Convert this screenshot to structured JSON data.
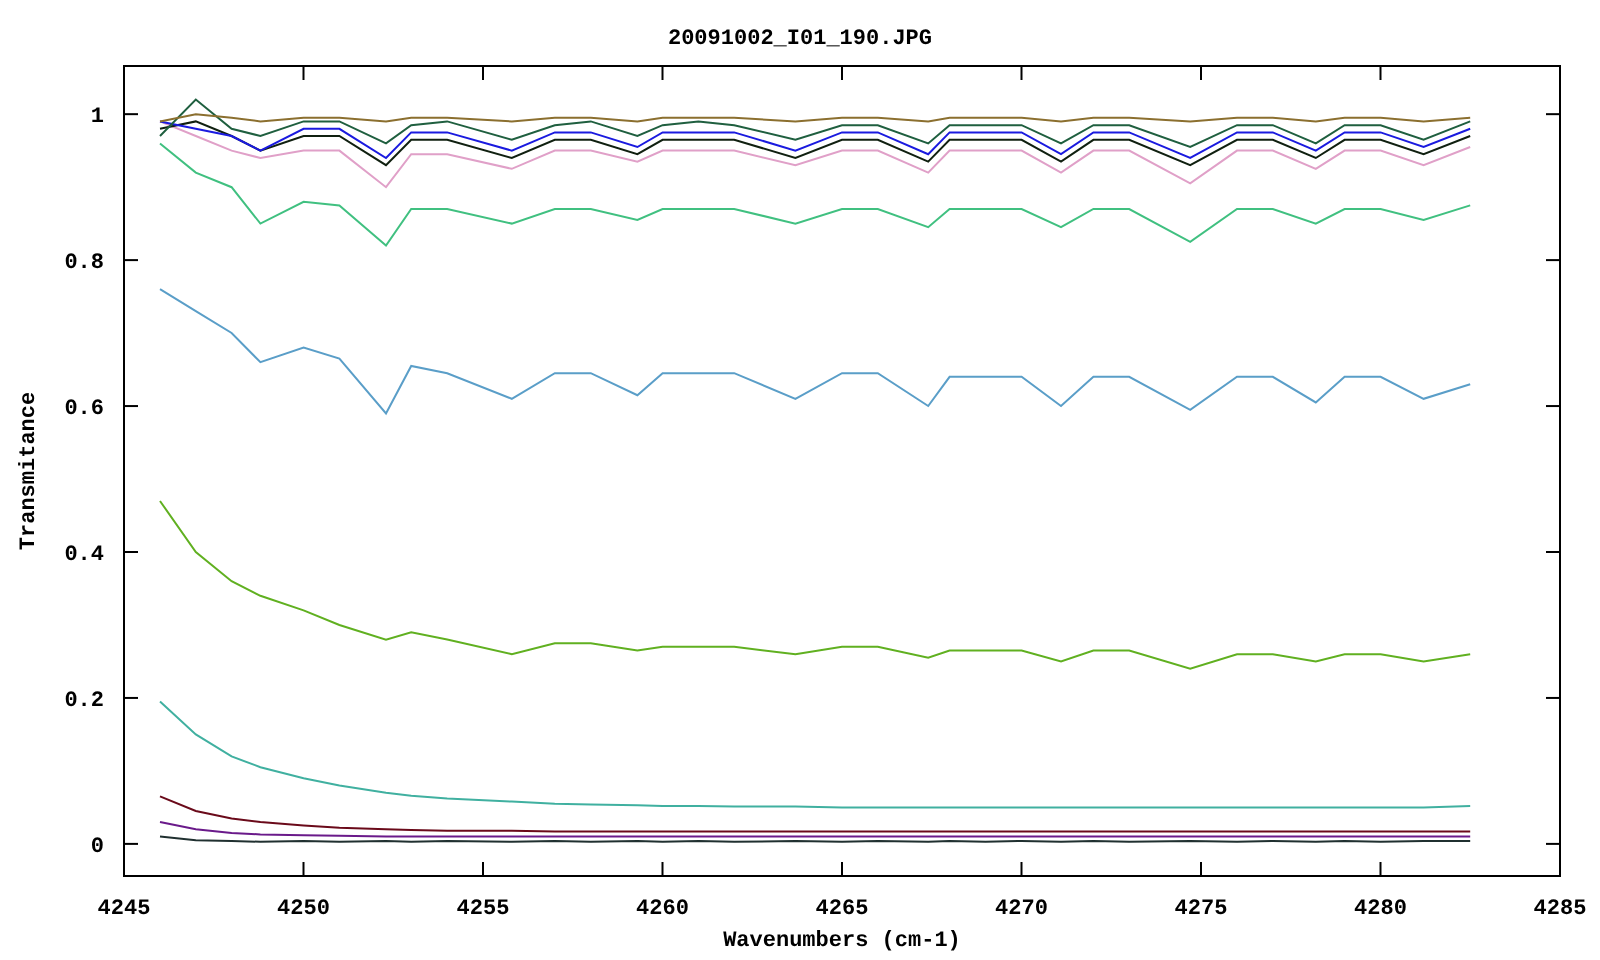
{
  "chart_data": {
    "type": "line",
    "title": "20091002_I01_190.JPG",
    "xlabel": "Wavenumbers (cm-1)",
    "ylabel": "Transmitance",
    "xlim": [
      4245,
      4285
    ],
    "ylim": [
      -0.044,
      1.066
    ],
    "xticks": [
      4245,
      4250,
      4255,
      4260,
      4265,
      4270,
      4275,
      4280,
      4285
    ],
    "yticks": [
      {
        "value": 0,
        "label": "0"
      },
      {
        "value": 0.2,
        "label": "0.2"
      },
      {
        "value": 0.4,
        "label": "0.4"
      },
      {
        "value": 0.6,
        "label": "0.6"
      },
      {
        "value": 0.8,
        "label": "0.8"
      },
      {
        "value": 1,
        "label": "1"
      }
    ],
    "x": [
      4246,
      4247,
      4248,
      4248.8,
      4250,
      4251,
      4252.3,
      4253,
      4254,
      4255.8,
      4257,
      4258,
      4259.3,
      4260,
      4261,
      4262,
      4263.7,
      4265,
      4266,
      4267.4,
      4268,
      4269,
      4270,
      4271.1,
      4272,
      4273,
      4274.7,
      4276,
      4277,
      4278.2,
      4279,
      4280,
      4281.2,
      4282.5
    ],
    "series": [
      {
        "color": "#8b6f2f",
        "values": [
          0.99,
          1.0,
          0.995,
          0.99,
          0.995,
          0.995,
          0.99,
          0.995,
          0.995,
          0.99,
          0.995,
          0.995,
          0.99,
          0.995,
          0.995,
          0.995,
          0.99,
          0.995,
          0.995,
          0.99,
          0.995,
          0.995,
          0.995,
          0.99,
          0.995,
          0.995,
          0.99,
          0.995,
          0.995,
          0.99,
          0.995,
          0.995,
          0.99,
          0.995
        ]
      },
      {
        "color": "#1f5f3f",
        "values": [
          0.97,
          1.02,
          0.98,
          0.97,
          0.99,
          0.99,
          0.96,
          0.985,
          0.99,
          0.965,
          0.985,
          0.99,
          0.97,
          0.985,
          0.99,
          0.985,
          0.965,
          0.985,
          0.985,
          0.96,
          0.985,
          0.985,
          0.985,
          0.96,
          0.985,
          0.985,
          0.955,
          0.985,
          0.985,
          0.96,
          0.985,
          0.985,
          0.965,
          0.99
        ]
      },
      {
        "color": "#1a1adf",
        "values": [
          0.99,
          0.98,
          0.97,
          0.95,
          0.98,
          0.98,
          0.94,
          0.975,
          0.975,
          0.95,
          0.975,
          0.975,
          0.955,
          0.975,
          0.975,
          0.975,
          0.95,
          0.975,
          0.975,
          0.945,
          0.975,
          0.975,
          0.975,
          0.945,
          0.975,
          0.975,
          0.94,
          0.975,
          0.975,
          0.95,
          0.975,
          0.975,
          0.955,
          0.98
        ]
      },
      {
        "color": "#102010",
        "values": [
          0.98,
          0.99,
          0.97,
          0.95,
          0.97,
          0.97,
          0.93,
          0.965,
          0.965,
          0.94,
          0.965,
          0.965,
          0.945,
          0.965,
          0.965,
          0.965,
          0.94,
          0.965,
          0.965,
          0.935,
          0.965,
          0.965,
          0.965,
          0.935,
          0.965,
          0.965,
          0.93,
          0.965,
          0.965,
          0.94,
          0.965,
          0.965,
          0.945,
          0.97
        ]
      },
      {
        "color": "#e0a0c8",
        "values": [
          0.99,
          0.97,
          0.95,
          0.94,
          0.95,
          0.95,
          0.9,
          0.945,
          0.945,
          0.925,
          0.95,
          0.95,
          0.935,
          0.95,
          0.95,
          0.95,
          0.93,
          0.95,
          0.95,
          0.92,
          0.95,
          0.95,
          0.95,
          0.92,
          0.95,
          0.95,
          0.905,
          0.95,
          0.95,
          0.925,
          0.95,
          0.95,
          0.93,
          0.955
        ]
      },
      {
        "color": "#40c080",
        "values": [
          0.96,
          0.92,
          0.9,
          0.85,
          0.88,
          0.875,
          0.82,
          0.87,
          0.87,
          0.85,
          0.87,
          0.87,
          0.855,
          0.87,
          0.87,
          0.87,
          0.85,
          0.87,
          0.87,
          0.845,
          0.87,
          0.87,
          0.87,
          0.845,
          0.87,
          0.87,
          0.825,
          0.87,
          0.87,
          0.85,
          0.87,
          0.87,
          0.855,
          0.875
        ]
      },
      {
        "color": "#5a9ec8",
        "values": [
          0.76,
          0.73,
          0.7,
          0.66,
          0.68,
          0.665,
          0.59,
          0.655,
          0.645,
          0.61,
          0.645,
          0.645,
          0.615,
          0.645,
          0.645,
          0.645,
          0.61,
          0.645,
          0.645,
          0.6,
          0.64,
          0.64,
          0.64,
          0.6,
          0.64,
          0.64,
          0.595,
          0.64,
          0.64,
          0.605,
          0.64,
          0.64,
          0.61,
          0.63
        ]
      },
      {
        "color": "#60b020",
        "values": [
          0.47,
          0.4,
          0.36,
          0.34,
          0.32,
          0.3,
          0.28,
          0.29,
          0.28,
          0.26,
          0.275,
          0.275,
          0.265,
          0.27,
          0.27,
          0.27,
          0.26,
          0.27,
          0.27,
          0.255,
          0.265,
          0.265,
          0.265,
          0.25,
          0.265,
          0.265,
          0.24,
          0.26,
          0.26,
          0.25,
          0.26,
          0.26,
          0.25,
          0.26
        ]
      },
      {
        "color": "#40b0a0",
        "values": [
          0.195,
          0.15,
          0.12,
          0.105,
          0.09,
          0.08,
          0.07,
          0.066,
          0.062,
          0.058,
          0.055,
          0.054,
          0.053,
          0.052,
          0.052,
          0.051,
          0.051,
          0.05,
          0.05,
          0.05,
          0.05,
          0.05,
          0.05,
          0.05,
          0.05,
          0.05,
          0.05,
          0.05,
          0.05,
          0.05,
          0.05,
          0.05,
          0.05,
          0.052
        ]
      },
      {
        "color": "#6a0a1a",
        "values": [
          0.065,
          0.045,
          0.035,
          0.03,
          0.025,
          0.022,
          0.02,
          0.019,
          0.018,
          0.018,
          0.017,
          0.017,
          0.017,
          0.017,
          0.017,
          0.017,
          0.017,
          0.017,
          0.017,
          0.017,
          0.017,
          0.017,
          0.017,
          0.017,
          0.017,
          0.017,
          0.017,
          0.017,
          0.017,
          0.017,
          0.017,
          0.017,
          0.017,
          0.017
        ]
      },
      {
        "color": "#6a1a8a",
        "values": [
          0.03,
          0.02,
          0.015,
          0.013,
          0.012,
          0.011,
          0.01,
          0.01,
          0.01,
          0.01,
          0.01,
          0.01,
          0.01,
          0.01,
          0.01,
          0.01,
          0.01,
          0.01,
          0.01,
          0.01,
          0.01,
          0.01,
          0.01,
          0.01,
          0.01,
          0.01,
          0.01,
          0.01,
          0.01,
          0.01,
          0.01,
          0.01,
          0.01,
          0.01
        ]
      },
      {
        "color": "#203030",
        "values": [
          0.01,
          0.005,
          0.004,
          0.003,
          0.004,
          0.003,
          0.004,
          0.003,
          0.004,
          0.003,
          0.004,
          0.003,
          0.004,
          0.003,
          0.004,
          0.003,
          0.004,
          0.003,
          0.004,
          0.003,
          0.004,
          0.003,
          0.004,
          0.003,
          0.004,
          0.003,
          0.004,
          0.003,
          0.004,
          0.003,
          0.004,
          0.003,
          0.004,
          0.004
        ]
      }
    ]
  }
}
